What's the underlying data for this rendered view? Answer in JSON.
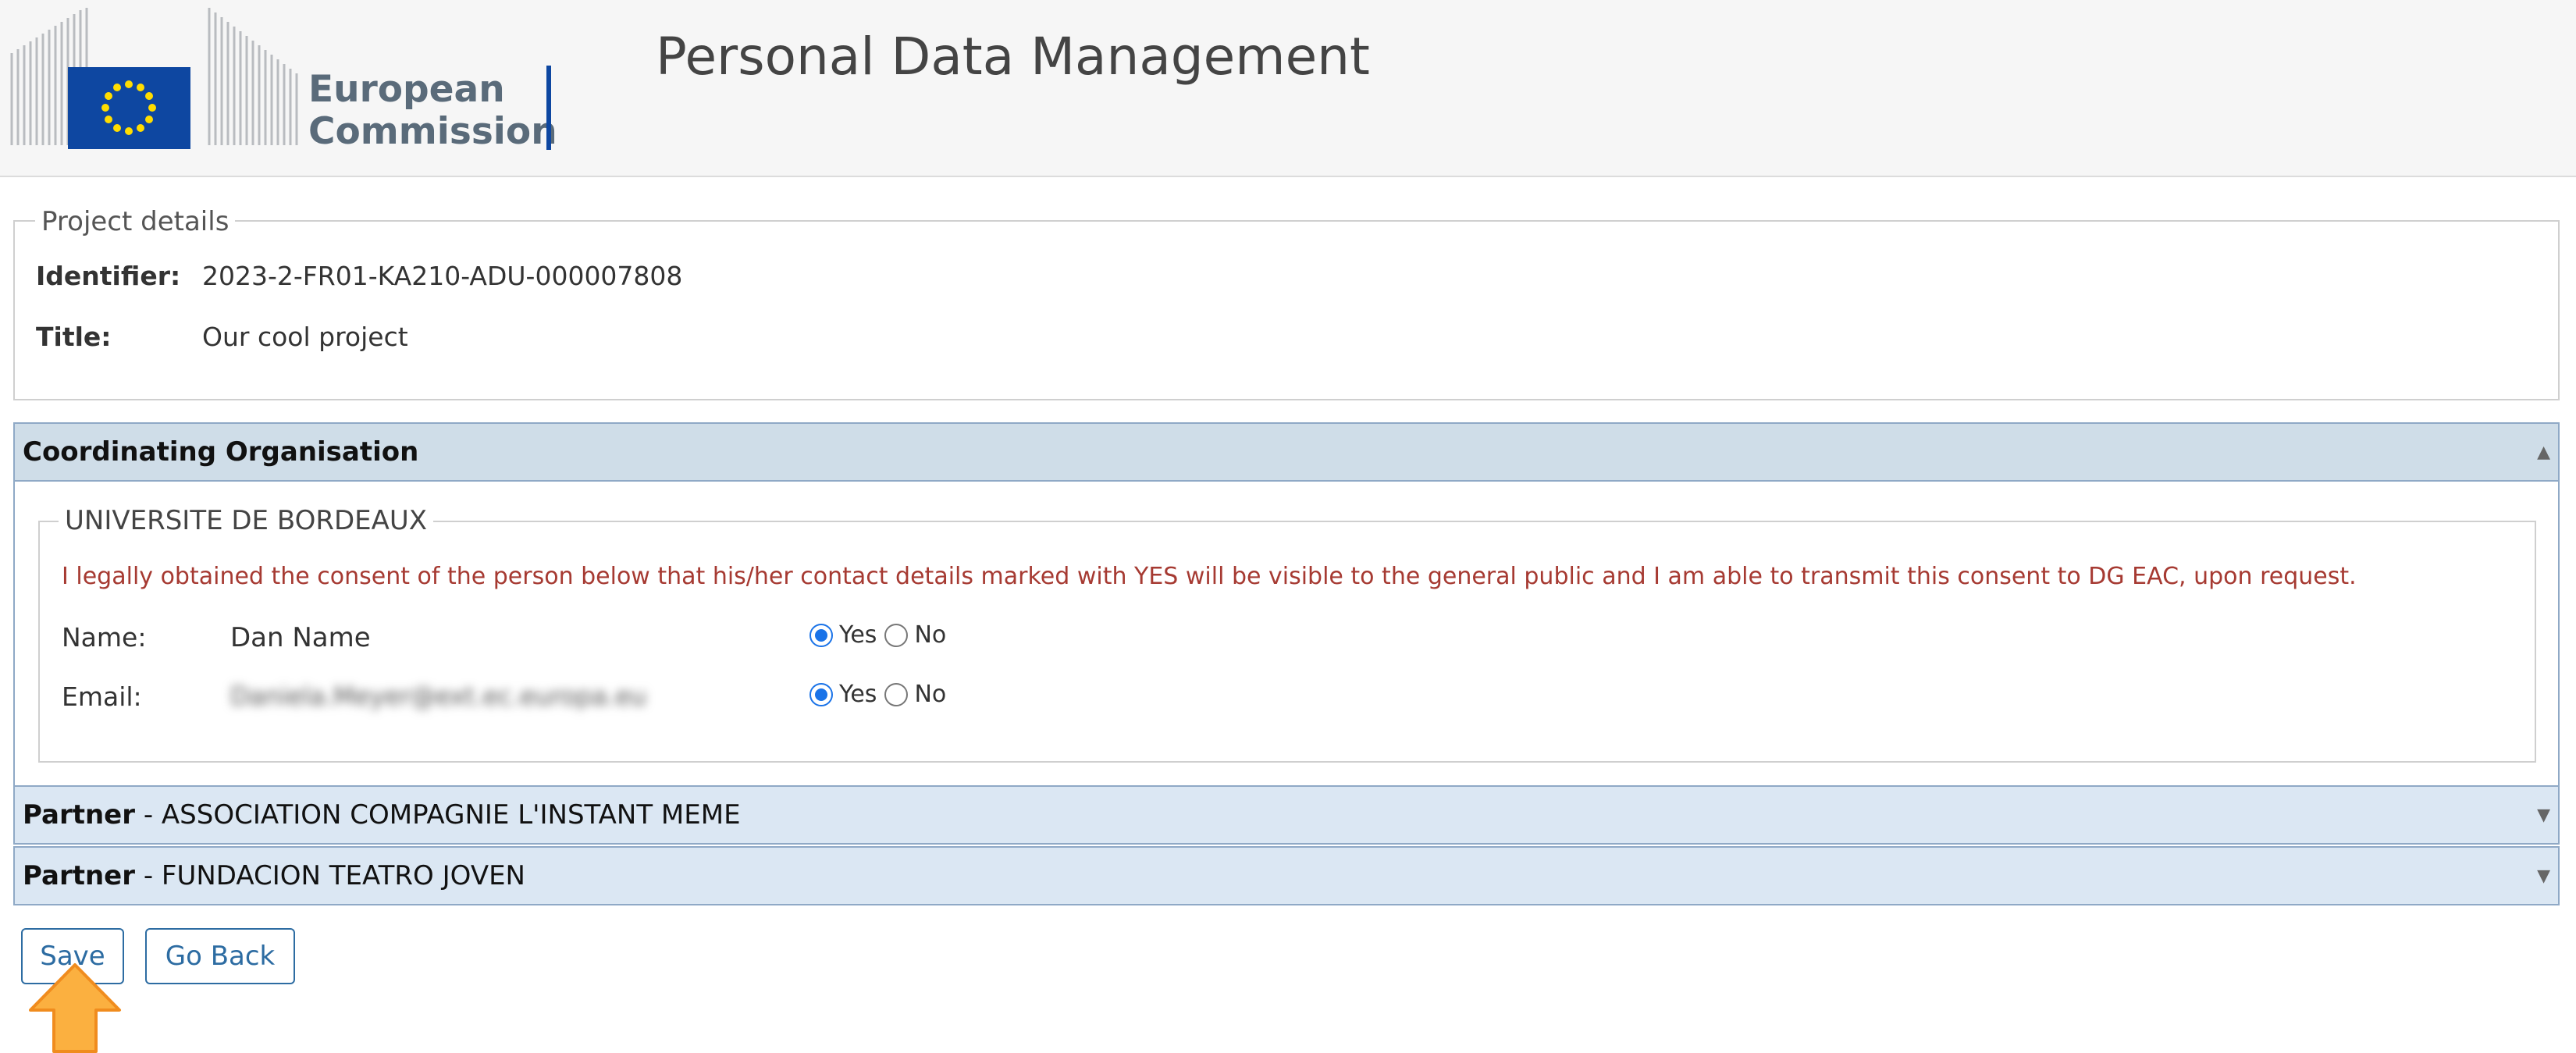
{
  "header": {
    "logo_text": [
      "European",
      "Commission"
    ],
    "app_title": "Personal Data Management"
  },
  "project": {
    "legend": "Project details",
    "identifier_label": "Identifier:",
    "identifier_value": "2023-2-FR01-KA210-ADU-000007808",
    "title_label": "Title:",
    "title_value": "Our cool project"
  },
  "coordinating": {
    "header": "Coordinating Organisation",
    "org_name": "UNIVERSITE DE BORDEAUX",
    "consent_text": "I legally obtained the consent of the person below that his/her contact details marked with YES will be visible to the general public and I am able to transmit this consent to DG EAC, upon request.",
    "name_label": "Name:",
    "name_value": "Dan Name",
    "email_label": "Email:",
    "email_value": "Daniela.Meyer@ext.ec.europa.eu",
    "yes_label": "Yes",
    "no_label": "No",
    "name_visible": "Yes",
    "email_visible": "Yes"
  },
  "partners": [
    {
      "prefix": "Partner",
      "name": " - ASSOCIATION COMPAGNIE L'INSTANT MEME"
    },
    {
      "prefix": "Partner",
      "name": " - FUNDACION TEATRO JOVEN"
    }
  ],
  "buttons": {
    "save": "Save",
    "go_back": "Go Back"
  },
  "colors": {
    "accordion_header": "#cfdde8",
    "consent_text": "#a63a32",
    "button_text": "#2d6ca2",
    "pointer_arrow": "#f5a623"
  },
  "icons": {
    "accordion_open": "triangle-up-icon",
    "accordion_closed": "triangle-down-icon",
    "pointer": "arrow-up-icon"
  }
}
